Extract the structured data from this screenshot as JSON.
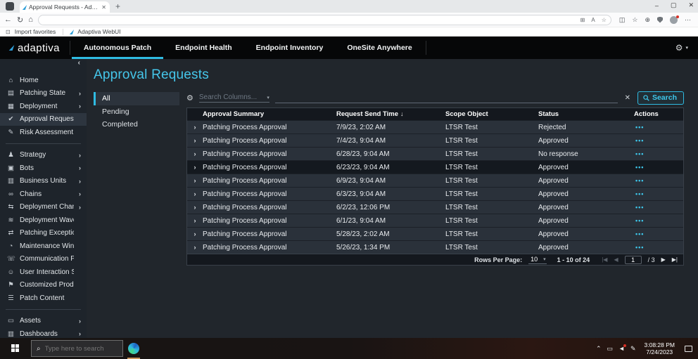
{
  "colors": {
    "accent_cyan": "#2fbbe2",
    "title_cyan": "#45c6ea",
    "appbar_black": "#060708",
    "sidebar_bg": "#1e242b",
    "main_bg": "#21262c",
    "row_bg": "#2a313a",
    "dark_row_bg": "#14191f",
    "taskbar_active_underline": "#c9935c"
  },
  "icons": {
    "chevron_right": "›",
    "chevron_left": "‹",
    "sort_desc": "↓",
    "row_expand": "›",
    "row_actions": "•••",
    "gear": "⚙",
    "caret_down": "▾",
    "clear_x": "✕",
    "back": "←",
    "refresh": "↻",
    "home": "⌂",
    "plus": "+",
    "minimize": "–",
    "restore": "▢",
    "close": "✕",
    "dots_menu": "⋯",
    "pager_first": "|◀",
    "pager_prev": "◀",
    "pager_next": "▶",
    "pager_last": "▶|",
    "tray_chevron": "⌃",
    "tray_monitor": "▭",
    "tray_volume": "◄",
    "tray_pen": "✎"
  },
  "browser": {
    "tab_title": "Approval Requests - Adaptiva A",
    "favorites_bar": {
      "import_label": "Import favorites",
      "bookmark_label": "Adaptiva WebUI"
    }
  },
  "app_bar": {
    "brand": "adaptiva",
    "tabs": [
      {
        "label": "Autonomous Patch",
        "active": true
      },
      {
        "label": "Endpoint Health"
      },
      {
        "label": "Endpoint Inventory"
      },
      {
        "label": "OneSite Anywhere"
      }
    ]
  },
  "sidebar": {
    "items": [
      {
        "label": "Home",
        "icon": "home-icon",
        "glyph": "⌂"
      },
      {
        "label": "Patching State",
        "icon": "patching-state-icon",
        "glyph": "▤",
        "chevron": true
      },
      {
        "label": "Deployment",
        "icon": "deployment-icon",
        "glyph": "▦",
        "chevron": true
      },
      {
        "label": "Approval Requests",
        "icon": "approval-requests-icon",
        "glyph": "✔",
        "active": true
      },
      {
        "label": "Risk Assessment Settings",
        "icon": "risk-assessment-icon",
        "glyph": "✎"
      },
      {
        "divider": true
      },
      {
        "label": "Strategy",
        "icon": "strategy-icon",
        "glyph": "♟",
        "chevron": true
      },
      {
        "label": "Bots",
        "icon": "bots-icon",
        "glyph": "▣",
        "chevron": true
      },
      {
        "label": "Business Units",
        "icon": "business-units-icon",
        "glyph": "▥",
        "chevron": true
      },
      {
        "label": "Chains",
        "icon": "chains-icon",
        "glyph": "∞",
        "chevron": true
      },
      {
        "label": "Deployment Channels",
        "icon": "deployment-channels-icon",
        "glyph": "⇆",
        "chevron": true
      },
      {
        "label": "Deployment Waves",
        "icon": "deployment-waves-icon",
        "glyph": "≋"
      },
      {
        "label": "Patching Exceptions",
        "icon": "patching-exceptions-icon",
        "glyph": "⇄"
      },
      {
        "label": "Maintenance Windows",
        "icon": "maintenance-windows-icon",
        "glyph": "◔"
      },
      {
        "label": "Communication Providers",
        "icon": "communication-providers-icon",
        "glyph": "☏"
      },
      {
        "label": "User Interaction Settings",
        "icon": "user-interaction-settings-icon",
        "glyph": "☺"
      },
      {
        "label": "Customized Products",
        "icon": "customized-products-icon",
        "glyph": "⚑"
      },
      {
        "label": "Patch Content",
        "icon": "patch-content-icon",
        "glyph": "☰"
      },
      {
        "divider": true
      },
      {
        "label": "Assets",
        "icon": "assets-icon",
        "glyph": "▭",
        "chevron": true
      },
      {
        "label": "Dashboards",
        "icon": "dashboards-icon",
        "glyph": "▥",
        "chevron": true
      }
    ]
  },
  "main": {
    "title": "Approval Requests",
    "filters": [
      {
        "label": "All",
        "active": true
      },
      {
        "label": "Pending"
      },
      {
        "label": "Completed"
      }
    ],
    "search": {
      "columns_placeholder": "Search Columns...",
      "button_label": "Search"
    },
    "table": {
      "columns": [
        "Approval Summary",
        "Request Send Time",
        "Scope Object",
        "Status",
        "Actions"
      ],
      "rows": [
        {
          "summary": "Patching Process Approval",
          "time": "7/9/23, 2:02 AM",
          "scope": "LTSR Test",
          "status": "Rejected"
        },
        {
          "summary": "Patching Process Approval",
          "time": "7/4/23, 9:04 AM",
          "scope": "LTSR Test",
          "status": "Approved"
        },
        {
          "summary": "Patching Process Approval",
          "time": "6/28/23, 9:04 AM",
          "scope": "LTSR Test",
          "status": "No response"
        },
        {
          "summary": "Patching Process Approval",
          "time": "6/23/23, 9:04 AM",
          "scope": "LTSR Test",
          "status": "Approved",
          "dark": true
        },
        {
          "summary": "Patching Process Approval",
          "time": "6/9/23, 9:04 AM",
          "scope": "LTSR Test",
          "status": "Approved"
        },
        {
          "summary": "Patching Process Approval",
          "time": "6/3/23, 9:04 AM",
          "scope": "LTSR Test",
          "status": "Approved"
        },
        {
          "summary": "Patching Process Approval",
          "time": "6/2/23, 12:06 PM",
          "scope": "LTSR Test",
          "status": "Approved"
        },
        {
          "summary": "Patching Process Approval",
          "time": "6/1/23, 9:04 AM",
          "scope": "LTSR Test",
          "status": "Approved"
        },
        {
          "summary": "Patching Process Approval",
          "time": "5/28/23, 2:02 AM",
          "scope": "LTSR Test",
          "status": "Approved"
        },
        {
          "summary": "Patching Process Approval",
          "time": "5/26/23, 1:34 PM",
          "scope": "LTSR Test",
          "status": "Approved"
        }
      ]
    },
    "pagination": {
      "rows_per_page_label": "Rows Per Page:",
      "rows_per_page": "10",
      "range": "1 - 10 of 24",
      "page": "1",
      "page_total": "/ 3"
    }
  },
  "taskbar": {
    "search_placeholder": "Type here to search",
    "time": "3:08:28 PM",
    "date": "7/24/2023"
  }
}
